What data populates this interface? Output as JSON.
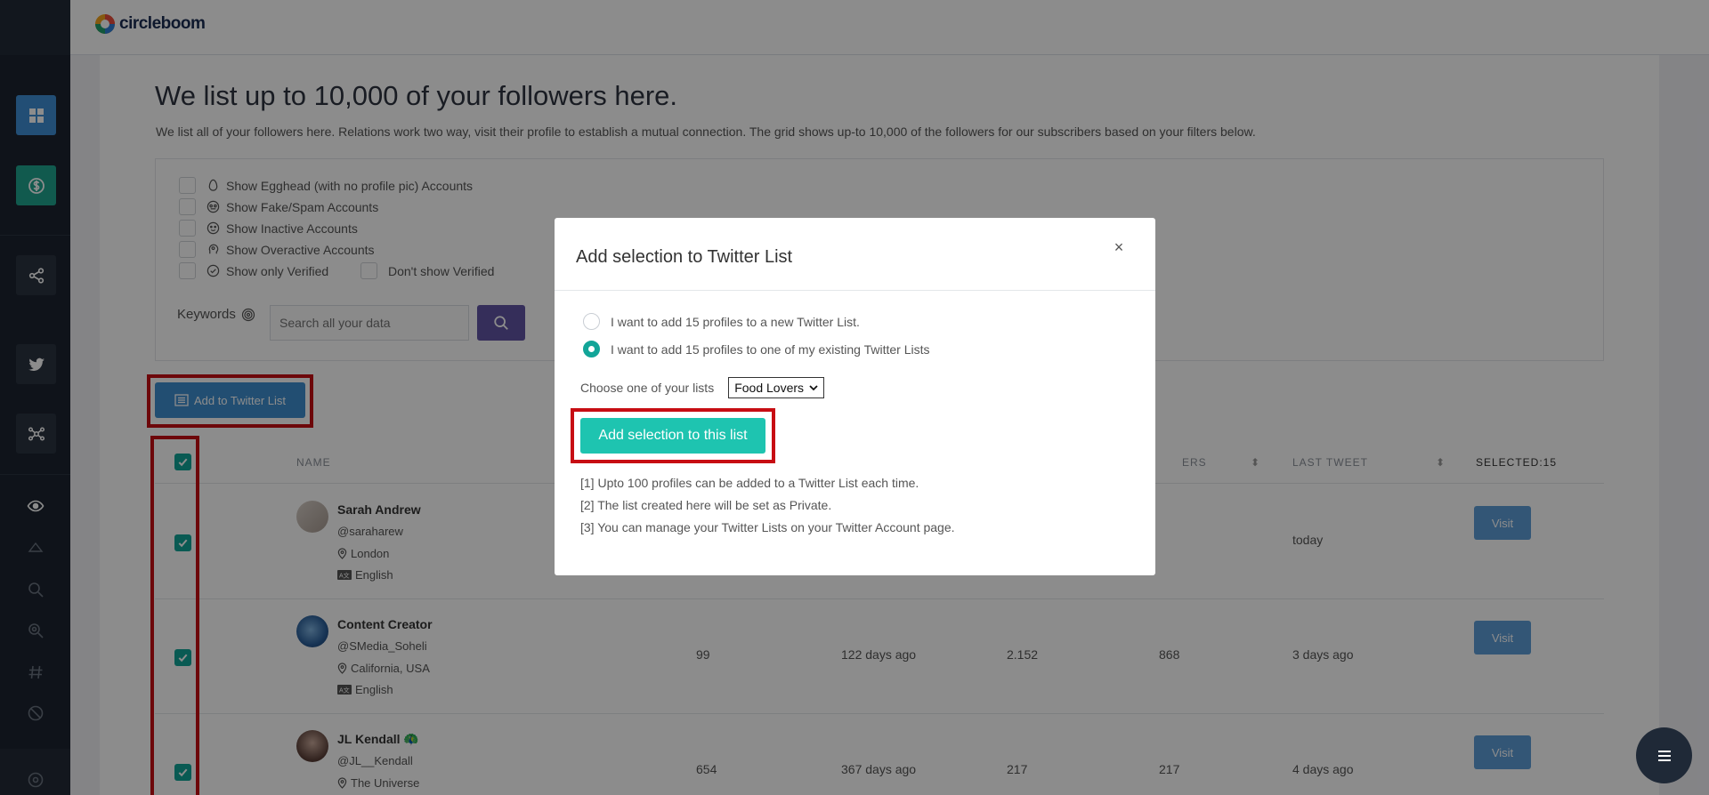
{
  "logo": {
    "text": "circleboom"
  },
  "page": {
    "title": "We list up to 10,000 of your followers here.",
    "subtitle": "We list all of your followers here. Relations work two way, visit their profile to establish a mutual connection. The grid shows up-to 10,000 of the followers for our subscribers based on your filters below."
  },
  "filters": {
    "egghead": "Show Egghead (with no profile pic) Accounts",
    "fake": "Show Fake/Spam Accounts",
    "inactive": "Show Inactive Accounts",
    "overactive": "Show Overactive Accounts",
    "verified": "Show only Verified",
    "not_verified": "Don't show Verified",
    "keywords_label": "Keywords",
    "search_placeholder": "Search all your data"
  },
  "actions": {
    "add_to_list": "Add to Twitter List"
  },
  "table": {
    "col_name": "NAME",
    "col_followers_partial": "ERS",
    "col_last_tweet": "LAST TWEET",
    "col_selected": "SELECTED:15",
    "visit_label": "Visit",
    "rows": [
      {
        "name": "Sarah Andrew",
        "handle": "@saraharew",
        "location": "London",
        "language": "English",
        "c1": "",
        "c2": "",
        "c3": "",
        "c4": "",
        "last_tweet": "today"
      },
      {
        "name": "Content Creator",
        "handle": "@SMedia_Soheli",
        "location": "California, USA",
        "language": "English",
        "c1": "99",
        "c2": "122 days ago",
        "c3": "2.152",
        "c4": "868",
        "last_tweet": "3 days ago"
      },
      {
        "name": "JL Kendall 🦚",
        "handle": "@JL__Kendall",
        "location": "The Universe",
        "language": "",
        "c1": "654",
        "c2": "367 days ago",
        "c3": "217",
        "c4": "217",
        "last_tweet": "4 days ago"
      }
    ]
  },
  "modal": {
    "title": "Add selection to Twitter List",
    "close": "×",
    "option_new": "I want to add 15 profiles to a new Twitter List.",
    "option_existing": "I want to add 15 profiles to one of my existing Twitter Lists",
    "choose_label": "Choose one of your lists",
    "selected_list": "Food Lovers",
    "add_button": "Add selection to this list",
    "note1": "[1] Upto 100 profiles can be added to a Twitter List each time.",
    "note2": "[2] The list created here will be set as Private.",
    "note3": "[3] You can manage your Twitter Lists on your Twitter Account page."
  },
  "colors": {
    "accent_teal": "#12a598",
    "primary_blue": "#3f8fd0",
    "highlight_red": "#c70d13",
    "search_purple": "#6255a5"
  }
}
